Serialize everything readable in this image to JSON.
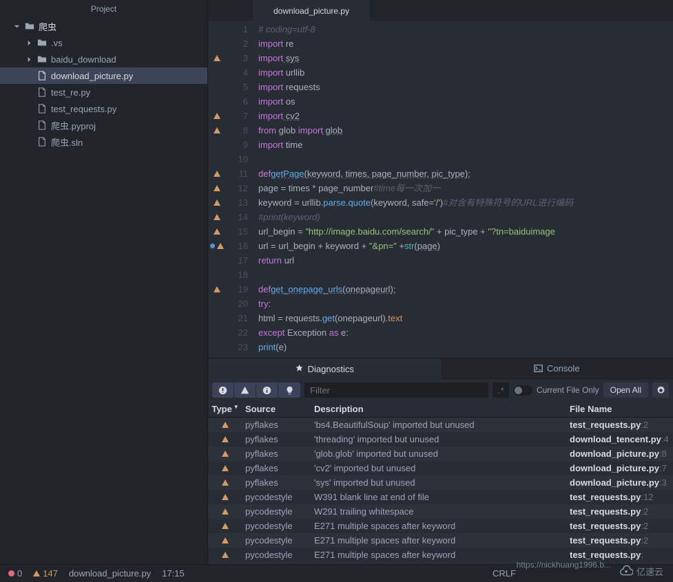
{
  "sidebar": {
    "title": "Project",
    "tree": [
      {
        "indent": 0,
        "chevron": "down",
        "icon": "folder",
        "label": "爬虫",
        "root": true
      },
      {
        "indent": 1,
        "chevron": "right",
        "icon": "folder",
        "label": ".vs"
      },
      {
        "indent": 1,
        "chevron": "right",
        "icon": "folder",
        "label": "baidu_download"
      },
      {
        "indent": 1,
        "icon": "file",
        "label": "download_picture.py",
        "selected": true
      },
      {
        "indent": 1,
        "icon": "file",
        "label": "test_re.py"
      },
      {
        "indent": 1,
        "icon": "file",
        "label": "test_requests.py"
      },
      {
        "indent": 1,
        "icon": "file",
        "label": "爬虫.pyproj"
      },
      {
        "indent": 1,
        "icon": "file",
        "label": "爬虫.sln"
      }
    ]
  },
  "editor": {
    "tab_label": "download_picture.py",
    "lines": [
      {
        "n": 1,
        "mark": "",
        "html": "<span class='c-comment'># coding=utf-8</span>"
      },
      {
        "n": 2,
        "mark": "",
        "html": "<span class='c-keyword'>import</span><span class='c-plain'> re</span>"
      },
      {
        "n": 3,
        "mark": "warn",
        "html": "<span class='c-keyword'>import</span><span class='c-plain dash-under'> sys</span>"
      },
      {
        "n": 4,
        "mark": "",
        "html": "<span class='c-keyword'>import</span><span class='c-plain'> urllib</span>"
      },
      {
        "n": 5,
        "mark": "",
        "html": "<span class='c-keyword'>import</span><span class='c-plain'> requests</span>"
      },
      {
        "n": 6,
        "mark": "",
        "html": "<span class='c-keyword'>import</span><span class='c-plain'> os</span>"
      },
      {
        "n": 7,
        "mark": "warn",
        "html": "<span class='c-keyword'>import</span><span class='c-plain dash-under'> cv2</span>"
      },
      {
        "n": 8,
        "mark": "warn",
        "html": "<span class='c-keyword'>from</span><span class='c-plain'> glob </span><span class='c-keyword'>import</span><span class='c-plain dash-under'> glob</span>"
      },
      {
        "n": 9,
        "mark": "",
        "html": "<span class='c-keyword'>import</span><span class='c-plain'> time</span>"
      },
      {
        "n": 10,
        "mark": "",
        "html": ""
      },
      {
        "n": 11,
        "mark": "warn",
        "html": "<span class='c-keyword'>def</span> <span class='c-name dash-under'>getPage</span><span class='c-plain dash-under'>(keyword, times, page_number, pic_type):</span>"
      },
      {
        "n": 12,
        "mark": "warn",
        "html": "    <span class='c-plain'>page = times * page_number</span><span class='c-comment'>#time每一次加一</span>"
      },
      {
        "n": 13,
        "mark": "warn",
        "html": "    <span class='c-plain'>keyword = urllib.</span><span class='c-name'>parse</span><span class='c-plain'>.</span><span class='c-name'>quote</span><span class='c-plain'>(keyword, </span><span class='c-param'>safe</span><span class='c-plain'>=</span><span class='c-string'>'/'</span><span class='c-plain'>)</span><span class='c-comment'>#对含有特殊符号的URL进行编码</span>"
      },
      {
        "n": 14,
        "mark": "warn",
        "html": "    <span class='c-comment'>#print(keyword)</span>"
      },
      {
        "n": 15,
        "mark": "warn",
        "html": "    <span class='c-plain'>url_begin = </span><span class='c-string'>\"http://image.baidu.com/search/\"</span><span class='c-plain'> + pic_type + </span><span class='c-string'>\"?tn=baiduimage</span>"
      },
      {
        "n": 16,
        "mark": "mod-warn",
        "html": "    <span class='c-plain'>url = url_begin + keyword + </span><span class='c-string'>\"&pn=\"</span><span class='c-plain'> +</span><span class='c-func'>str</span><span class='c-plain dash-under'>(page)</span>"
      },
      {
        "n": 17,
        "mark": "",
        "html": "    <span class='c-keyword'>return</span><span class='c-plain'> url</span>"
      },
      {
        "n": 18,
        "mark": "",
        "html": ""
      },
      {
        "n": 19,
        "mark": "warn",
        "html": "<span class='c-keyword'>def</span> <span class='c-name dash-under'>get_onepage_urls</span><span class='c-plain dash-under'>(onepageurl):</span>"
      },
      {
        "n": 20,
        "mark": "",
        "html": "    <span class='c-keyword'>try</span><span class='c-plain'>:</span>"
      },
      {
        "n": 21,
        "mark": "",
        "html": "        <span class='c-plain'>html = requests.</span><span class='c-name'>get</span><span class='c-plain'>(onepageurl).</span><span class='c-attr'>text</span>"
      },
      {
        "n": 22,
        "mark": "",
        "html": "    <span class='c-keyword'>except</span><span class='c-plain'> Exception </span><span class='c-keyword'>as</span><span class='c-plain'> e:</span>"
      },
      {
        "n": 23,
        "mark": "",
        "html": "        <span class='c-name'>print</span><span class='c-plain'>(e)</span>"
      }
    ]
  },
  "panels": {
    "diagnostics_label": "Diagnostics",
    "console_label": "Console",
    "filter_placeholder": "Filter",
    "filter_icon": ".*",
    "currentfile_label": "Current File Only",
    "openall_label": "Open All",
    "headers": {
      "type": "Type",
      "source": "Source",
      "desc": "Description",
      "file": "File Name"
    },
    "rows": [
      {
        "type": "warn",
        "source": "pyflakes",
        "desc": "'bs4.BeautifulSoup' imported but unused",
        "file": "test_requests.py",
        "line": ":2"
      },
      {
        "type": "warn",
        "source": "pyflakes",
        "desc": "'threading' imported but unused",
        "file": "download_tencent.py",
        "line": ":4"
      },
      {
        "type": "warn",
        "source": "pyflakes",
        "desc": "'glob.glob' imported but unused",
        "file": "download_picture.py",
        "line": ":8"
      },
      {
        "type": "warn",
        "source": "pyflakes",
        "desc": "'cv2' imported but unused",
        "file": "download_picture.py",
        "line": ":7"
      },
      {
        "type": "warn",
        "source": "pyflakes",
        "desc": "'sys' imported but unused",
        "file": "download_picture.py",
        "line": ":3"
      },
      {
        "type": "warn",
        "source": "pycodestyle",
        "desc": "W391 blank line at end of file",
        "file": "test_requests.py",
        "line": ":12"
      },
      {
        "type": "warn",
        "source": "pycodestyle",
        "desc": "W291 trailing whitespace",
        "file": "test_requests.py",
        "line": ":2"
      },
      {
        "type": "warn",
        "source": "pycodestyle",
        "desc": "E271 multiple spaces after keyword",
        "file": "test_requests.py",
        "line": ":2"
      },
      {
        "type": "warn",
        "source": "pycodestyle",
        "desc": "E271 multiple spaces after keyword",
        "file": "test_requests.py",
        "line": ":2"
      },
      {
        "type": "warn",
        "source": "pycodestyle",
        "desc": "E271 multiple spaces after keyword",
        "file": "test_requests.py",
        "line": ":"
      }
    ]
  },
  "statusbar": {
    "errors": "0",
    "warnings": "147",
    "file": "download_picture.py",
    "time": "17:15",
    "encoding": "CRLF"
  },
  "watermark": {
    "url": "https://nickhuang1996.b...",
    "brand": "亿速云"
  }
}
